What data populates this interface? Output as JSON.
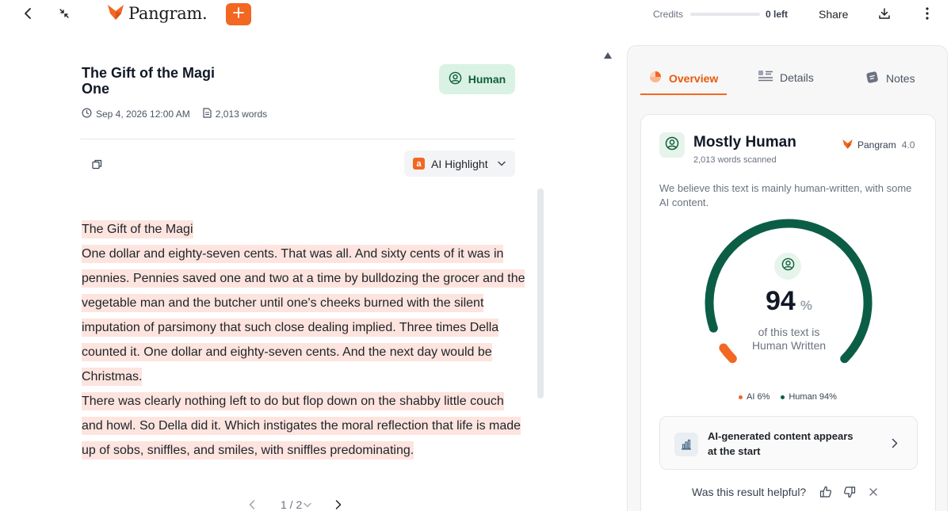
{
  "topbar": {
    "brand_name": "Pangram.",
    "credits_label": "Credits",
    "credits_progress": 0,
    "credits_left": "0 left",
    "share_label": "Share"
  },
  "document": {
    "title_line1": "The Gift of the Magi",
    "title_line2": "One",
    "classification_label": "Human",
    "date": "Sep 4, 2026 12:00 AM",
    "word_count": "2,013 words",
    "highlight_mode": "AI Highlight",
    "highlight_badge": "a",
    "paragraphs": [
      "The Gift of the Magi",
      "One dollar and eighty-seven cents. That was all. And sixty cents of it was in pennies. Pennies saved one and two at a time by bulldozing the grocer and the vegetable man and the butcher until one's cheeks burned with the silent imputation of parsimony that such close dealing implied. Three times Della counted it. One dollar and eighty-seven cents. And the next day would be Christmas.",
      "There was clearly nothing left to do but flop down on the shabby little couch and howl. So Della did it. Which instigates the moral reflection that life is made up of sobs, sniffles, and smiles, with sniffles predominating."
    ],
    "page_indicator": "1 / 2"
  },
  "panel": {
    "tabs": [
      {
        "label": "Overview",
        "active": true
      },
      {
        "label": "Details",
        "active": false
      },
      {
        "label": "Notes",
        "active": false
      }
    ],
    "result": {
      "title": "Mostly Human",
      "words_scanned": "2,013 words scanned",
      "brand": "Pangram",
      "version": "4.0",
      "description": "We believe this text is mainly human-written, with some AI content.",
      "percent": "94",
      "percent_sign": "%",
      "caption_line1": "of this text is",
      "caption_line2": "Human Written",
      "ai_share": 6,
      "human_share": 94,
      "legend_ai": "AI 6%",
      "legend_human": "Human 94%",
      "insight_line1": "AI-generated content appears",
      "insight_line2": "at the start",
      "feedback_question": "Was this result helpful?"
    }
  },
  "colors": {
    "accent": "#f26722",
    "human_green": "#0b5e45",
    "ai_highlight": "#fde4df",
    "human_pill_bg": "#d9f2e4"
  },
  "icons": [
    "back-arrow-icon",
    "collapse-icon",
    "fox-logo-icon",
    "plus-icon",
    "download-icon",
    "more-vertical-icon",
    "user-circle-icon",
    "calendar-clock-icon",
    "document-icon",
    "copy-icon",
    "chevron-down-icon",
    "chevron-left-icon",
    "chevron-right-icon",
    "caret-up-icon",
    "overview-pie-icon",
    "details-list-icon",
    "notes-icon",
    "bar-chart-icon",
    "thumbs-up-icon",
    "thumbs-down-icon",
    "close-icon"
  ]
}
